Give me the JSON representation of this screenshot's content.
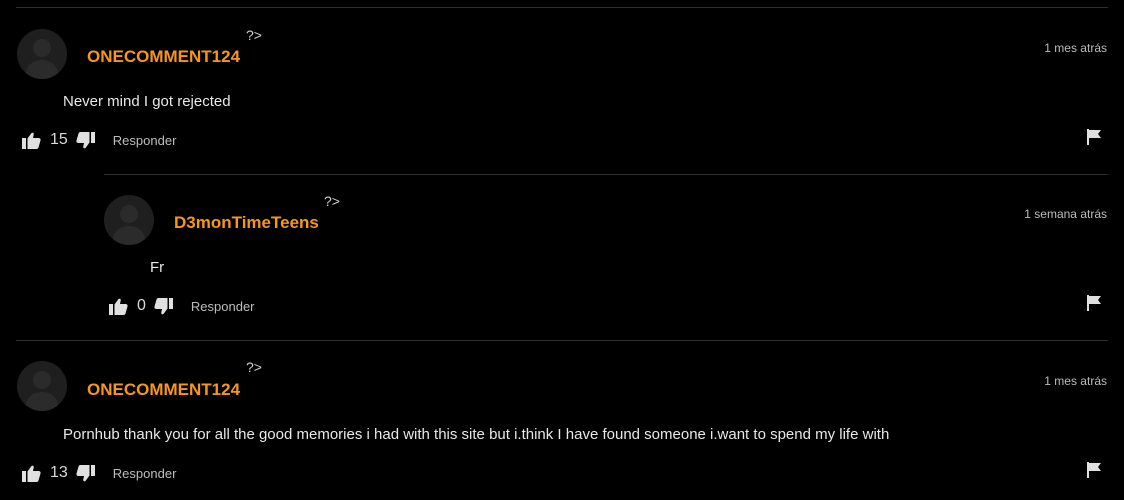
{
  "comments": [
    {
      "username": "ONECOMMENT124",
      "php_tag": "?>",
      "timestamp": "1 mes atrás",
      "text": "Never mind I got rejected",
      "votes": "15",
      "reply_label": "Responder"
    },
    {
      "username": "D3monTimeTeens",
      "php_tag": "?>",
      "timestamp": "1 semana atrás",
      "text": "Fr",
      "votes": "0",
      "reply_label": "Responder"
    },
    {
      "username": "ONECOMMENT124",
      "php_tag": "?>",
      "timestamp": "1 mes atrás",
      "text": "Pornhub thank you for all the good memories i had with this site but i.think I have found someone i.want to spend my life with",
      "votes": "13",
      "reply_label": "Responder"
    }
  ],
  "colors": {
    "username": "#f7961e",
    "background": "#000000",
    "divider": "#2e2e2e"
  },
  "icons": [
    "thumbs-up-icon",
    "thumbs-down-icon",
    "flag-icon",
    "avatar-placeholder"
  ]
}
